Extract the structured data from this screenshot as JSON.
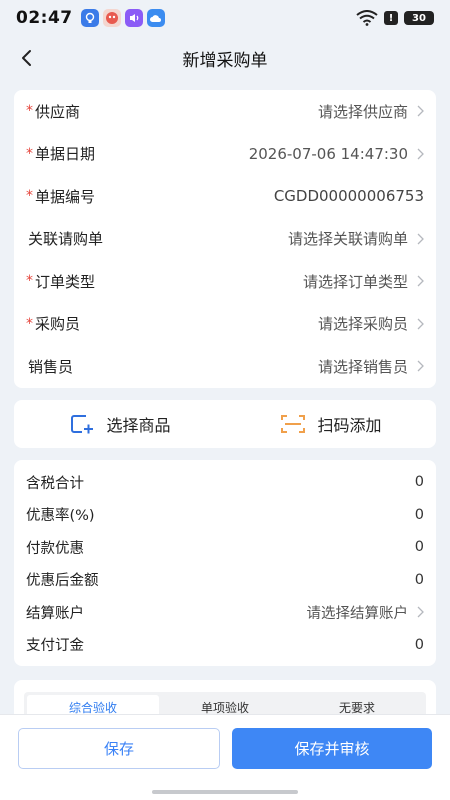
{
  "status": {
    "time": "02:47",
    "battery": "30",
    "app_icons": [
      "bulb-app-icon",
      "face-app-icon",
      "sound-app-icon",
      "cloud-app-icon"
    ]
  },
  "nav": {
    "title": "新增采购单"
  },
  "form": {
    "rows": [
      {
        "label": "供应商",
        "value": "请选择供应商",
        "required": true,
        "chevron": true
      },
      {
        "label": "单据日期",
        "value": "2026-07-06 14:47:30",
        "required": true,
        "chevron": true
      },
      {
        "label": "单据编号",
        "value": "CGDD00000006753",
        "required": true,
        "chevron": false
      },
      {
        "label": "关联请购单",
        "value": "请选择关联请购单",
        "required": false,
        "chevron": true
      },
      {
        "label": "订单类型",
        "value": "请选择订单类型",
        "required": true,
        "chevron": true
      },
      {
        "label": "采购员",
        "value": "请选择采购员",
        "required": true,
        "chevron": true
      },
      {
        "label": "销售员",
        "value": "请选择销售员",
        "required": false,
        "chevron": true
      }
    ]
  },
  "actions": {
    "select_goods": "选择商品",
    "scan_add": "扫码添加"
  },
  "summary": {
    "rows": [
      {
        "label": "含税合计",
        "value": "0"
      },
      {
        "label": "优惠率(%)",
        "value": "0"
      },
      {
        "label": "付款优惠",
        "value": "0"
      },
      {
        "label": "优惠后金额",
        "value": "0"
      },
      {
        "label": "结算账户",
        "value": "请选择结算账户"
      },
      {
        "label": "支付订金",
        "value": "0"
      }
    ]
  },
  "acceptance": {
    "tabs": [
      "综合验收",
      "单项验收",
      "无要求"
    ],
    "active": "综合验收"
  },
  "bottom": {
    "save": "保存",
    "save_and_review": "保存并审核"
  },
  "colors": {
    "accent": "#3e87f5",
    "required": "#e5453b",
    "scan_icon": "#f0a04b"
  }
}
